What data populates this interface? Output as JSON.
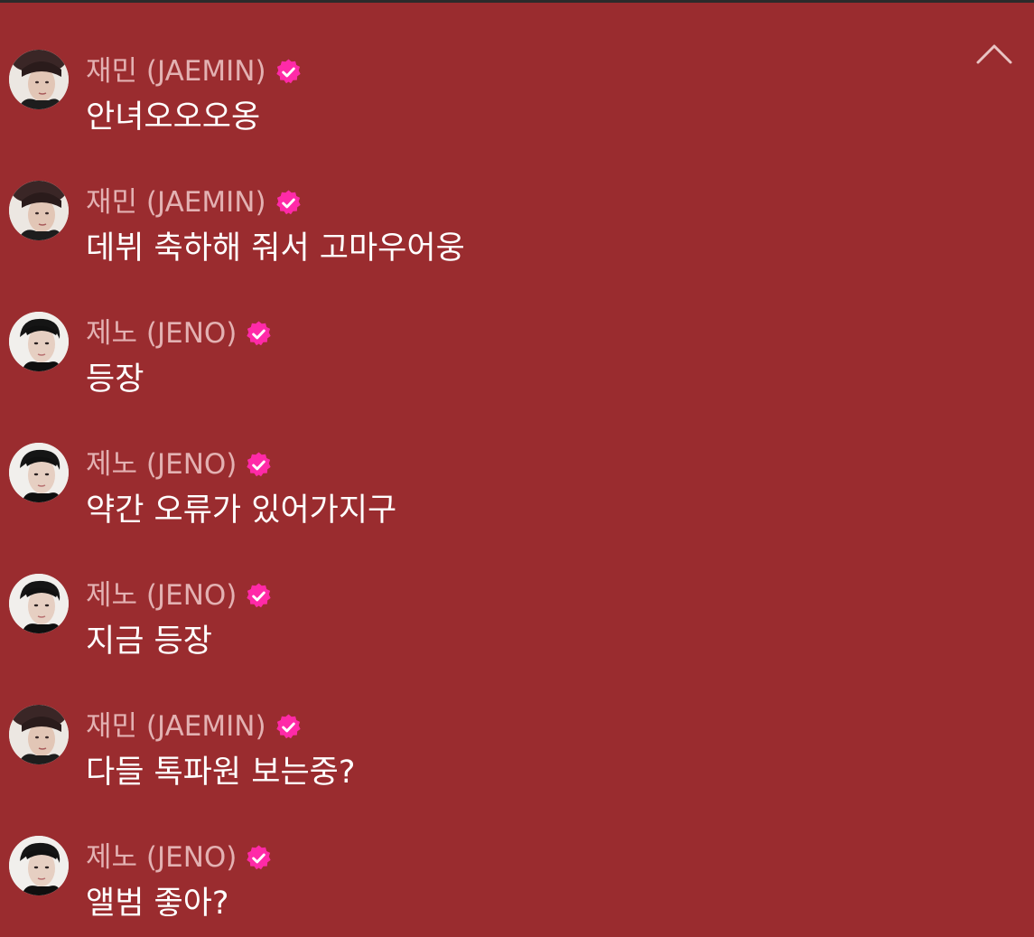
{
  "colors": {
    "background": "#9a2c2f",
    "name_text": "#e3b1b2",
    "message_text": "#ffffff",
    "verified_badge": "#ff2aa8"
  },
  "header": {
    "collapse_icon": "chevron-up-icon"
  },
  "messages": [
    {
      "author": "재민 (JAEMIN)",
      "verified": true,
      "avatar": "jaemin-avatar",
      "text": "안녀오오오옹"
    },
    {
      "author": "재민 (JAEMIN)",
      "verified": true,
      "avatar": "jaemin-avatar",
      "text": "데뷔 축하해 줘서 고마우어웅"
    },
    {
      "author": "제노 (JENO)",
      "verified": true,
      "avatar": "jeno-avatar",
      "text": "등장"
    },
    {
      "author": "제노 (JENO)",
      "verified": true,
      "avatar": "jeno-avatar",
      "text": "약간 오류가 있어가지구"
    },
    {
      "author": "제노 (JENO)",
      "verified": true,
      "avatar": "jeno-avatar",
      "text": "지금 등장"
    },
    {
      "author": "재민 (JAEMIN)",
      "verified": true,
      "avatar": "jaemin-avatar",
      "text": "다들 톡파원 보는중?"
    },
    {
      "author": "제노 (JENO)",
      "verified": true,
      "avatar": "jeno-avatar",
      "text": "앨범 좋아?"
    }
  ]
}
